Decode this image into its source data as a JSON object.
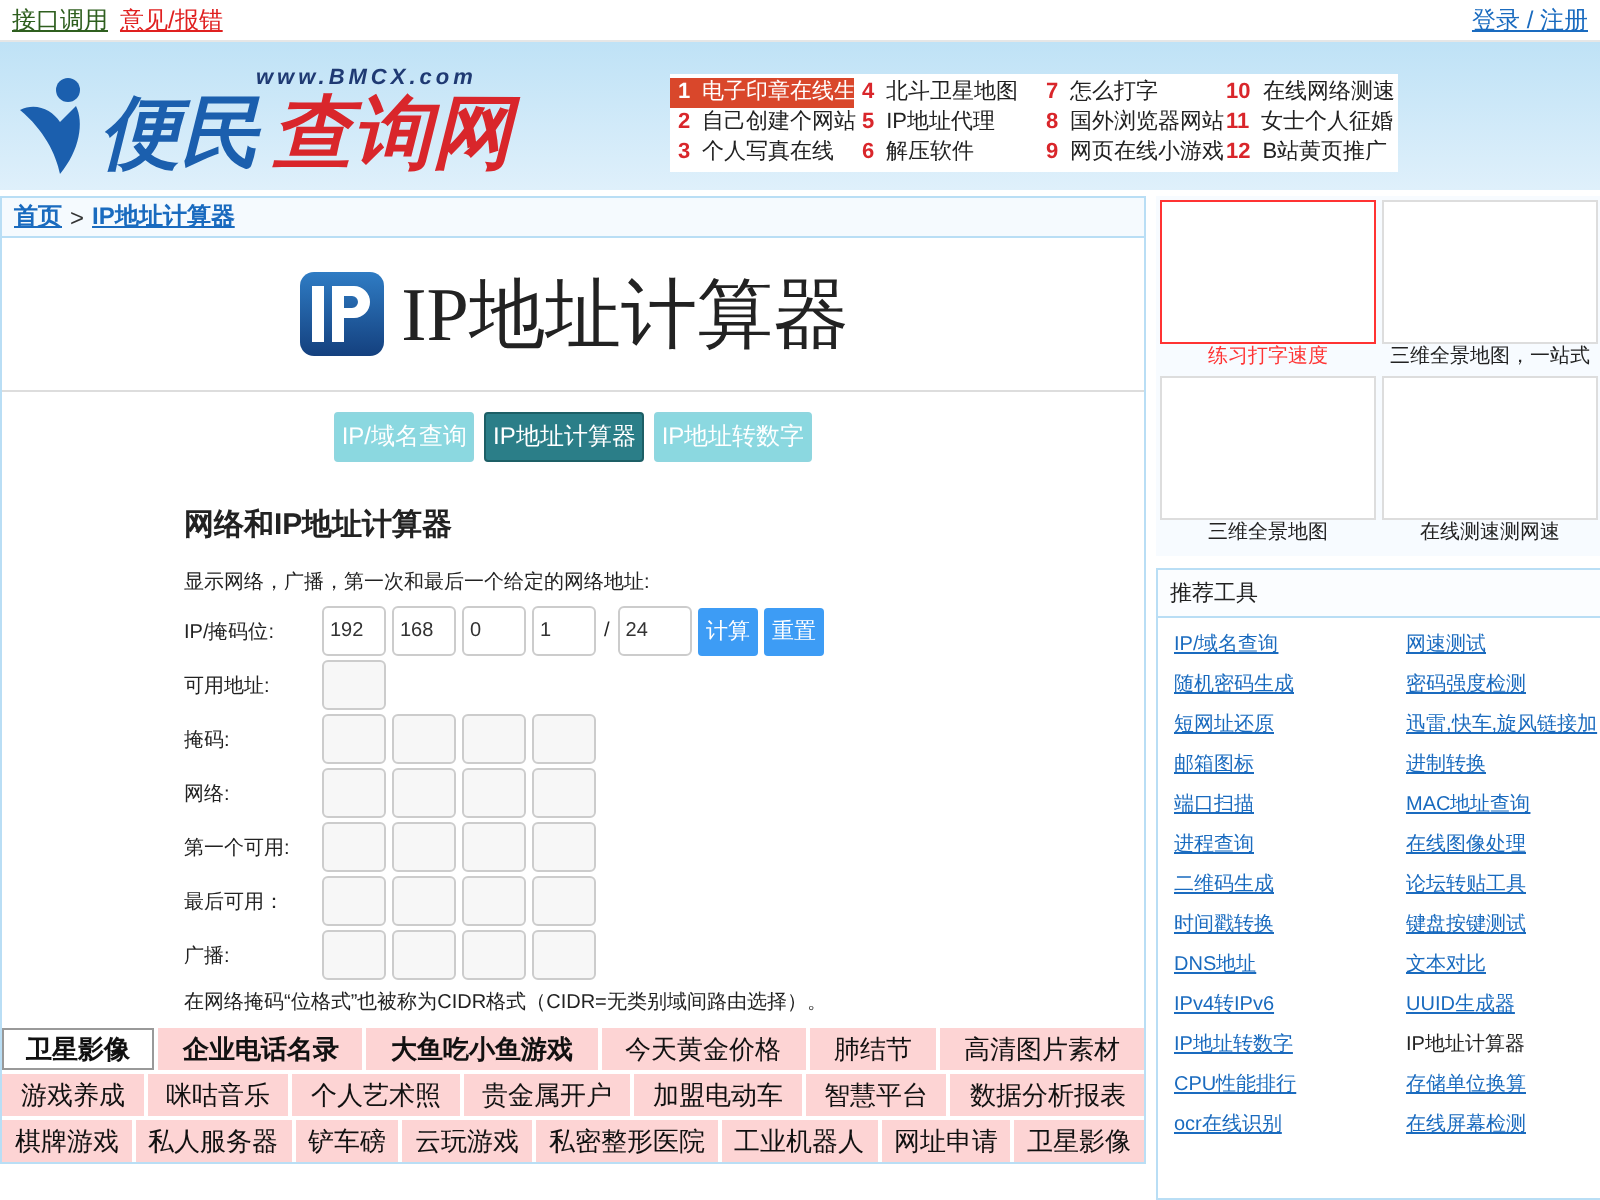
{
  "top_bar": {
    "links": [
      {
        "label": "接口调用",
        "kind": "plain"
      },
      {
        "label": "意见/报错",
        "kind": "alert"
      }
    ],
    "account": "登录 / 注册"
  },
  "header": {
    "logo": {
      "name": "便民",
      "accent": "查询网",
      "domain": "www.BMCX.com"
    },
    "hot_links": [
      {
        "num": "1",
        "label": "电子印章在线生",
        "selected": true
      },
      {
        "num": "4",
        "label": "北斗卫星地图",
        "selected": false
      },
      {
        "num": "7",
        "label": "怎么打字",
        "selected": false
      },
      {
        "num": "10",
        "label": "在线网络测速",
        "selected": false
      },
      {
        "num": "2",
        "label": "自己创建个网站",
        "selected": false
      },
      {
        "num": "5",
        "label": "IP地址代理",
        "selected": false
      },
      {
        "num": "8",
        "label": "国外浏览器网站",
        "selected": false
      },
      {
        "num": "11",
        "label": "女士个人征婚",
        "selected": false
      },
      {
        "num": "3",
        "label": "个人写真在线",
        "selected": false
      },
      {
        "num": "6",
        "label": "解压软件",
        "selected": false
      },
      {
        "num": "9",
        "label": "网页在线小游戏",
        "selected": false
      },
      {
        "num": "12",
        "label": "B站黄页推广",
        "selected": false
      }
    ]
  },
  "breadcrumb": {
    "home": "首页",
    "separator": ">",
    "current": "IP地址计算器"
  },
  "page_title": "IP地址计算器",
  "tabs": [
    {
      "label": "IP/域名查询",
      "selected": false
    },
    {
      "label": "IP地址计算器",
      "selected": true
    },
    {
      "label": "IP地址转数字",
      "selected": false
    }
  ],
  "calculator": {
    "heading": "网络和IP地址计算器",
    "intro": "显示网络，广播，第一次和最后一个给定的网络地址:",
    "input_label": "IP/掩码位:",
    "octets": [
      "192",
      "168",
      "0",
      "1"
    ],
    "slash": "/",
    "prefix": "24",
    "buttons": [
      {
        "label": "计算"
      },
      {
        "label": "重置"
      }
    ],
    "results": [
      {
        "label": "可用地址:",
        "kind": "single"
      },
      {
        "label": "掩码:",
        "kind": "quad"
      },
      {
        "label": "网络:",
        "kind": "quad"
      },
      {
        "label": "第一个可用:",
        "kind": "quad"
      },
      {
        "label": "最后可用：",
        "kind": "quad"
      },
      {
        "label": "广播:",
        "kind": "quad"
      }
    ],
    "note": "在网络掩码“位格式”也被称为CIDR格式（CIDR=无类别域间路由选择）。"
  },
  "tag_rows": [
    [
      {
        "label": "卫星影像",
        "bold": true,
        "highlighted": true
      },
      {
        "label": "企业电话名录",
        "bold": true,
        "highlighted": false
      },
      {
        "label": "大鱼吃小鱼游戏",
        "bold": true,
        "highlighted": false
      },
      {
        "label": "今天黄金价格",
        "bold": false,
        "highlighted": false
      },
      {
        "label": "肺结节",
        "bold": false,
        "highlighted": false
      },
      {
        "label": "高清图片素材",
        "bold": false,
        "highlighted": false
      }
    ],
    [
      {
        "label": "游戏养成",
        "bold": false,
        "highlighted": false
      },
      {
        "label": "咪咕音乐",
        "bold": false,
        "highlighted": false
      },
      {
        "label": "个人艺术照",
        "bold": false,
        "highlighted": false
      },
      {
        "label": "贵金属开户",
        "bold": false,
        "highlighted": false
      },
      {
        "label": "加盟电动车",
        "bold": false,
        "highlighted": false
      },
      {
        "label": "智慧平台",
        "bold": false,
        "highlighted": false
      },
      {
        "label": "数据分析报表",
        "bold": false,
        "highlighted": false
      }
    ],
    [
      {
        "label": "棋牌游戏",
        "bold": false,
        "highlighted": false
      },
      {
        "label": "私人服务器",
        "bold": false,
        "highlighted": false
      },
      {
        "label": "铲车磅",
        "bold": false,
        "highlighted": false
      },
      {
        "label": "云玩游戏",
        "bold": false,
        "highlighted": false
      },
      {
        "label": "私密整形医院",
        "bold": false,
        "highlighted": false
      },
      {
        "label": "工业机器人",
        "bold": false,
        "highlighted": false
      },
      {
        "label": "网址申请",
        "bold": false,
        "highlighted": false
      },
      {
        "label": "卫星影像",
        "bold": false,
        "highlighted": false
      }
    ]
  ],
  "promos": [
    {
      "caption": "练习打字速度",
      "selected": true
    },
    {
      "caption": "三维全景地图，一站式",
      "selected": false
    },
    {
      "caption": "三维全景地图",
      "selected": false
    },
    {
      "caption": "在线测速测网速",
      "selected": false
    }
  ],
  "recommended": {
    "title": "推荐工具",
    "items": [
      {
        "label": "IP/域名查询",
        "current": false
      },
      {
        "label": "网速测试",
        "current": false
      },
      {
        "label": "随机密码生成",
        "current": false
      },
      {
        "label": "密码强度检测",
        "current": false
      },
      {
        "label": "短网址还原",
        "current": false
      },
      {
        "label": "迅雷,快车,旋风链接加",
        "current": false
      },
      {
        "label": "邮箱图标",
        "current": false
      },
      {
        "label": "进制转换",
        "current": false
      },
      {
        "label": "端口扫描",
        "current": false
      },
      {
        "label": "MAC地址查询",
        "current": false
      },
      {
        "label": "进程查询",
        "current": false
      },
      {
        "label": "在线图像处理",
        "current": false
      },
      {
        "label": "二维码生成",
        "current": false
      },
      {
        "label": "论坛转贴工具",
        "current": false
      },
      {
        "label": "时间戳转换",
        "current": false
      },
      {
        "label": "键盘按键测试",
        "current": false
      },
      {
        "label": "DNS地址",
        "current": false
      },
      {
        "label": "文本对比",
        "current": false
      },
      {
        "label": "IPv4转IPv6",
        "current": false
      },
      {
        "label": "UUID生成器",
        "current": false
      },
      {
        "label": "IP地址转数字",
        "current": false
      },
      {
        "label": "IP地址计算器",
        "current": true
      },
      {
        "label": "CPU性能排行",
        "current": false
      },
      {
        "label": "存储单位换算",
        "current": false
      },
      {
        "label": "ocr在线识别",
        "current": false
      },
      {
        "label": "在线屏幕检测",
        "current": false
      }
    ]
  }
}
